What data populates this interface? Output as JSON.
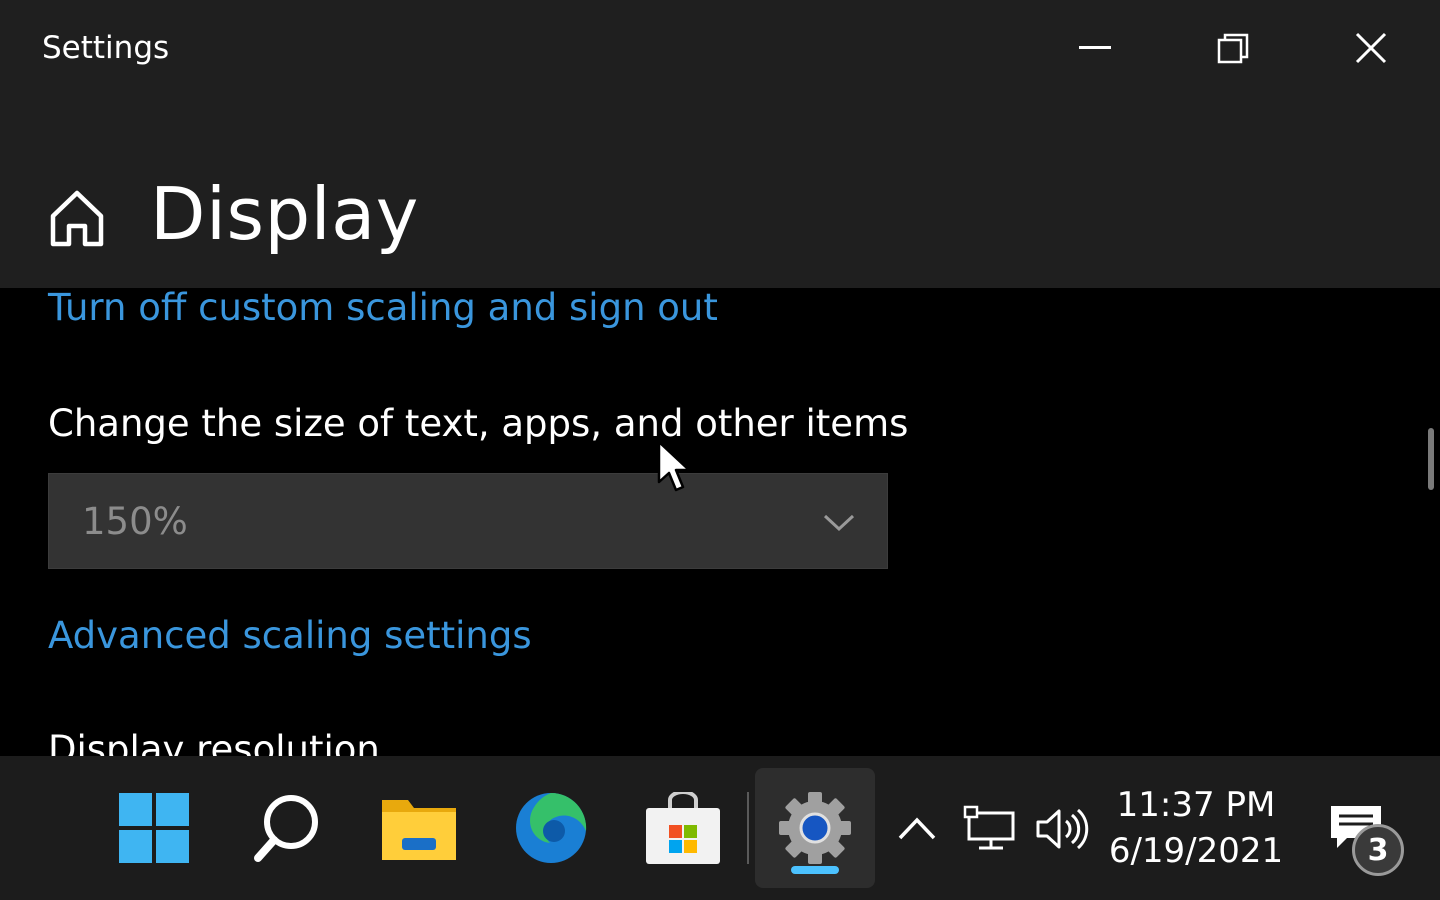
{
  "window": {
    "title": "Settings",
    "controls": {
      "minimize": "minimize-icon",
      "maximize": "restore-icon",
      "close": "close-icon"
    }
  },
  "header": {
    "home_icon": "home-icon",
    "title": "Display"
  },
  "content": {
    "custom_scaling_link": "Turn off custom scaling and sign out",
    "scale_label": "Change the size of text, apps, and other items",
    "scale_dropdown": {
      "value": "150%",
      "disabled": true
    },
    "advanced_link": "Advanced scaling settings",
    "resolution_heading": "Display resolution"
  },
  "taskbar": {
    "items": [
      {
        "name": "start",
        "icon": "windows-logo-icon"
      },
      {
        "name": "search",
        "icon": "search-icon"
      },
      {
        "name": "file-explorer",
        "icon": "folder-icon"
      },
      {
        "name": "edge",
        "icon": "edge-icon"
      },
      {
        "name": "store",
        "icon": "store-icon"
      },
      {
        "name": "settings",
        "icon": "gear-icon",
        "active": true
      }
    ],
    "tray": {
      "overflow_icon": "chevron-up-icon",
      "network_icon": "network-icon",
      "volume_icon": "volume-icon",
      "time": "11:37 PM",
      "date": "6/19/2021",
      "notification_count": "3"
    }
  },
  "colors": {
    "accent_link": "#3a96dd",
    "titlebar_bg": "#1f1f1f",
    "content_bg": "#000000",
    "taskbar_bg": "#1c1c1c",
    "active_indicator": "#4cc2ff"
  }
}
